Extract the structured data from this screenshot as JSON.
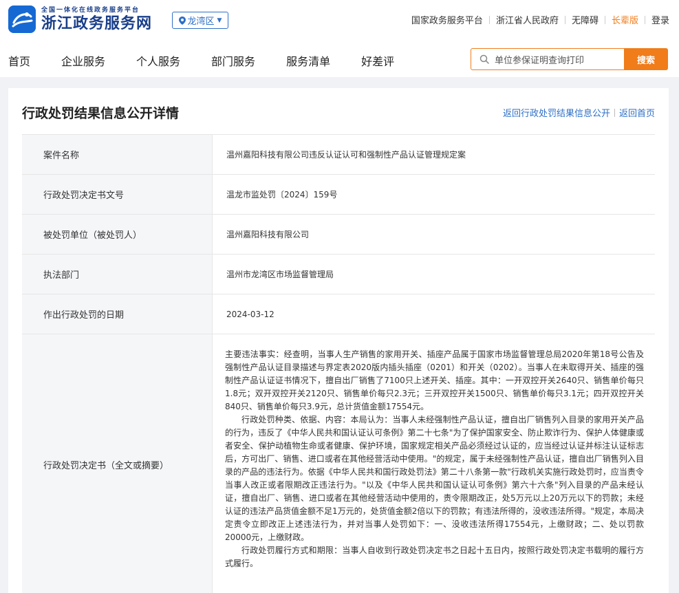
{
  "header": {
    "logo_sub": "全国一体化在线政务服务平台",
    "logo_main": "浙江政务服务网",
    "region": "龙湾区",
    "links": [
      "国家政务服务平台",
      "浙江省人民政府",
      "无障碍",
      "长辈版",
      "登录"
    ]
  },
  "nav": {
    "items": [
      "首页",
      "企业服务",
      "个人服务",
      "部门服务",
      "服务清单",
      "好差评"
    ]
  },
  "search": {
    "value": "单位参保证明查询打印",
    "button_label": "搜索"
  },
  "page": {
    "title": "行政处罚结果信息公开详情",
    "back_link": "返回行政处罚结果信息公开",
    "home_link": "返回首页"
  },
  "details": {
    "rows": [
      {
        "label": "案件名称",
        "value": "温州嘉阳科技有限公司违反认证认可和强制性产品认证管理规定案"
      },
      {
        "label": "行政处罚决定书文号",
        "value": "温龙市监处罚〔2024〕159号"
      },
      {
        "label": "被处罚单位（被处罚人）",
        "value": "温州嘉阳科技有限公司"
      },
      {
        "label": "执法部门",
        "value": "温州市龙湾区市场监督管理局"
      },
      {
        "label": "作出行政处罚的日期",
        "value": "2024-03-12"
      }
    ],
    "decision_label": "行政处罚决定书（全文或摘要）",
    "decision_paragraphs": [
      "主要违法事实：经查明，当事人生产销售的家用开关、插座产品属于国家市场监督管理总局2020年第18号公告及强制性产品认证目录描述与界定表2020版内插头插座（0201）和开关（0202）。当事人在未取得开关、插座的强制性产品认证证书情况下，擅自出厂销售了7100只上述开关、插座。其中：一开双控开关2640只、销售单价每只1.8元；双开双控开关2120只、销售单价每只2.3元；三开双控开关1500只、销售单价每只3.1元；四开双控开关840只、销售单价每只3.9元，总计货值金额17554元。",
      "行政处罚种类、依据、内容：本局认为：当事人未经强制性产品认证，擅自出厂销售列入目录的家用开关产品的行为，违反了《中华人民共和国认证认可条例》第二十七条\"为了保护国家安全、防止欺诈行为、保护人体健康或者安全、保护动植物生命或者健康、保护环境，国家规定相关产品必须经过认证的，应当经过认证并标注认证标志后，方可出厂、销售、进口或者在其他经营活动中使用。\"的规定，属于未经强制性产品认证，擅自出厂销售列入目录的产品的违法行为。依据《中华人民共和国行政处罚法》第二十八条第一款\"行政机关实施行政处罚时，应当责令当事人改正或者限期改正违法行为。\"以及《中华人民共和国认证认可条例》第六十六条\"列入目录的产品未经认证，擅自出厂、销售、进口或者在其他经营活动中使用的，责令限期改正，处5万元以上20万元以下的罚款；未经认证的违法产品货值金额不足1万元的，处货值金额2倍以下的罚款；有违法所得的，没收违法所得。\"规定，本局决定责令立即改正上述违法行为，并对当事人处罚如下：一、没收违法所得17554元，上缴财政；二、处以罚款20000元，上缴财政。",
      "行政处罚履行方式和期限：当事人自收到行政处罚决定书之日起十五日内，按照行政处罚决定书载明的履行方式履行。"
    ]
  },
  "colors": {
    "accent_orange": "#f07c1a",
    "link_blue": "#2e6fc6",
    "brand_blue": "#1a3f8a"
  }
}
